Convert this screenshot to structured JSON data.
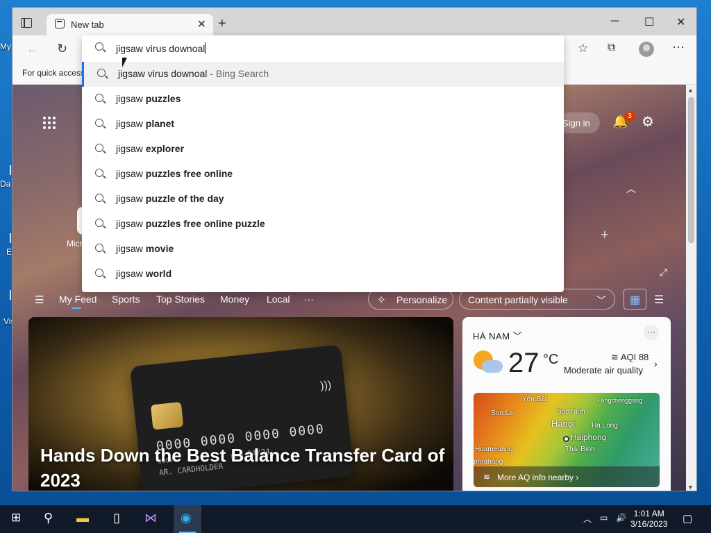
{
  "desktop": {
    "icons": [
      {
        "label": "My"
      },
      {
        "label": "Da"
      },
      {
        "label": "E"
      },
      {
        "label": "Vis"
      }
    ]
  },
  "browser": {
    "tab": {
      "title": "New tab",
      "close_icon": "close-icon"
    },
    "window": {
      "minimize": "─",
      "maximize": "☐",
      "close": "✕"
    },
    "favbar": {
      "text": "For quick access"
    },
    "omnibox": {
      "value": "jigsaw virus downoal"
    },
    "suggestions": [
      {
        "prefix": "jigsaw virus downoal",
        "bold": "",
        "suffix": " - Bing Search"
      },
      {
        "prefix": "jigsaw ",
        "bold": "puzzles",
        "suffix": ""
      },
      {
        "prefix": "jigsaw ",
        "bold": "planet",
        "suffix": ""
      },
      {
        "prefix": "jigsaw ",
        "bold": "explorer",
        "suffix": ""
      },
      {
        "prefix": "jigsaw ",
        "bold": "puzzles free online",
        "suffix": ""
      },
      {
        "prefix": "jigsaw ",
        "bold": "puzzle of the day",
        "suffix": ""
      },
      {
        "prefix": "jigsaw ",
        "bold": "puzzles free online puzzle",
        "suffix": ""
      },
      {
        "prefix": "jigsaw ",
        "bold": "movie",
        "suffix": ""
      },
      {
        "prefix": "jigsaw ",
        "bold": "world",
        "suffix": ""
      }
    ]
  },
  "newtab": {
    "signin": "Sign in",
    "notification_count": "3",
    "quicklink_label": "Micr",
    "feed_nav": {
      "items": [
        "My Feed",
        "Sports",
        "Top Stories",
        "Money",
        "Local",
        "···"
      ],
      "personalize": "Personalize",
      "content_visibility": "Content partially visible"
    },
    "hero": {
      "title": "Hands Down the Best Balance Transfer Card of 2023",
      "card_numbers": "0000 0000 0000 0000",
      "card_small": "0000",
      "card_holder": "AR. CARDHOLDER",
      "card_expiry": "04/24",
      "card_thru": "THRU"
    },
    "weather": {
      "location": "HÀ NAM",
      "temperature": "27",
      "unit": "°C",
      "aqi": "AQI 88",
      "aqi_desc": "Moderate air quality",
      "map_labels": [
        "Yên Bái",
        "Fangchenggang",
        "Son La",
        "Bac Ninh",
        "Hanoi",
        "Ha Long",
        "Haiphong",
        "Huameuang",
        "Thái Bình",
        "phrabang"
      ],
      "map_link": "More AQ info nearby"
    }
  },
  "taskbar": {
    "time": "1:01 AM",
    "date": "3/16/2023"
  },
  "colors": {
    "accent": "#1a73e8",
    "badge": "#d83b01",
    "taskbar": "#101a28"
  }
}
